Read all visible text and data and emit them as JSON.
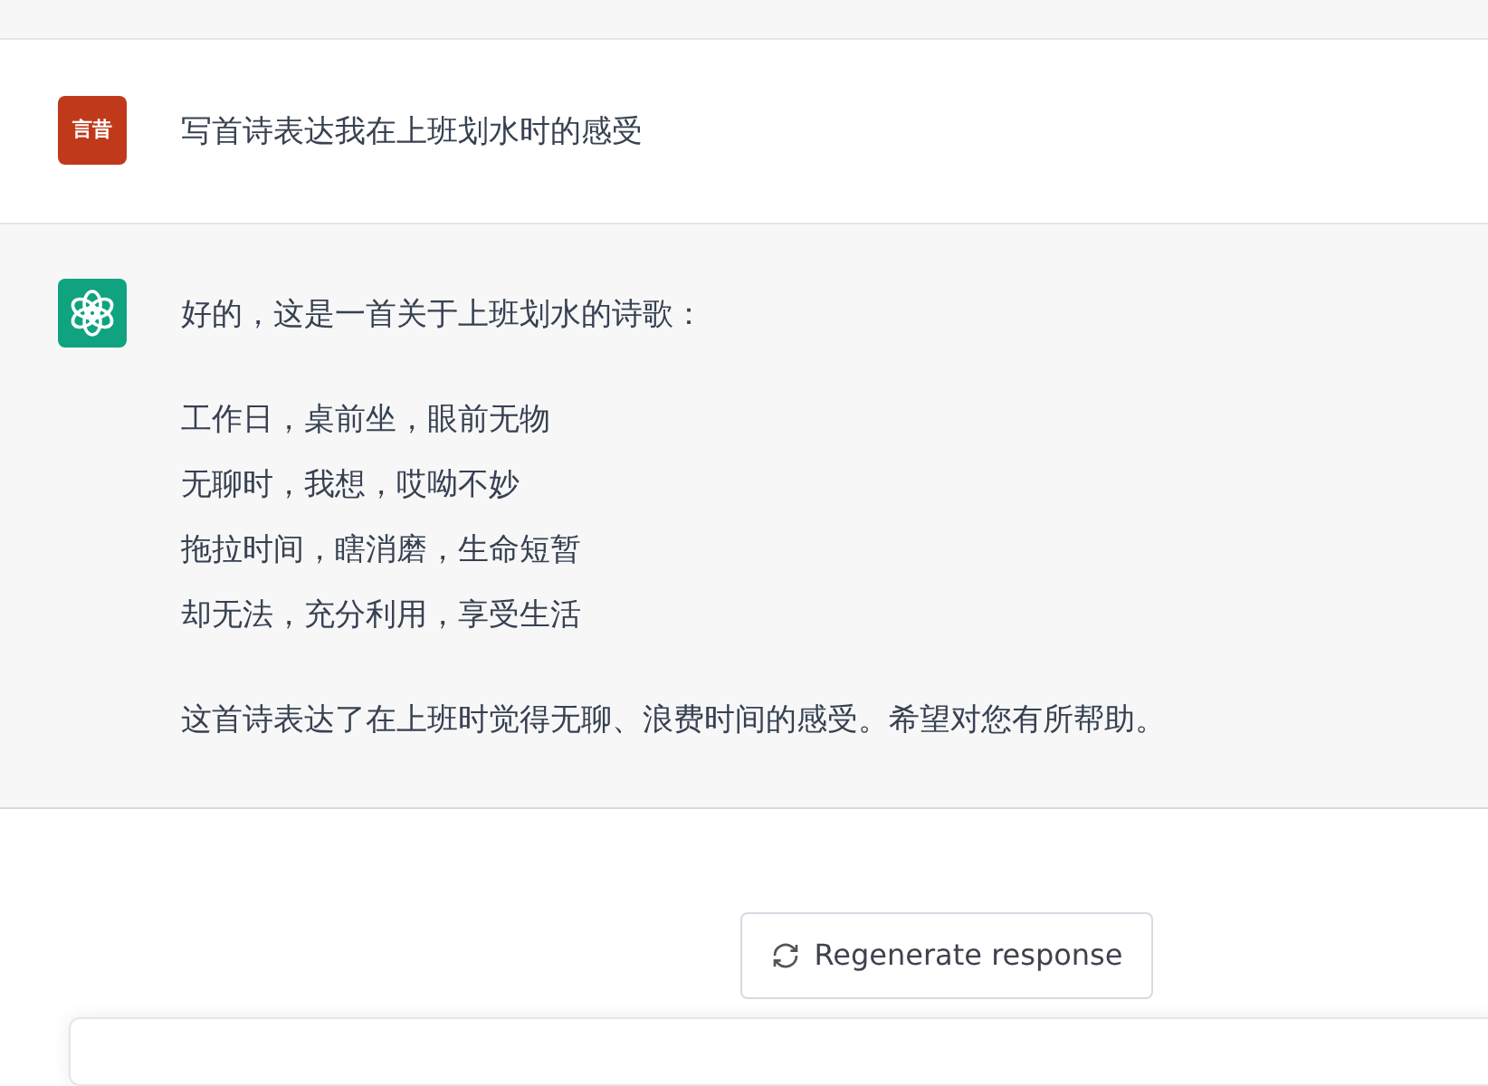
{
  "messages": [
    {
      "kind": "user",
      "avatar_text": "言昔",
      "paragraphs": [
        [
          "写首诗表达我在上班划水时的感受"
        ]
      ]
    },
    {
      "kind": "assistant",
      "paragraphs": [
        [
          "好的，这是一首关于上班划水的诗歌："
        ],
        [
          "工作日，桌前坐，眼前无物",
          "无聊时，我想，哎呦不妙",
          "拖拉时间，瞎消磨，生命短暂",
          "却无法，充分利用，享受生活"
        ],
        [
          "这首诗表达了在上班时觉得无聊、浪费时间的感受。希望对您有所帮助。"
        ]
      ]
    }
  ],
  "regenerate_button": {
    "label": "Regenerate response"
  }
}
